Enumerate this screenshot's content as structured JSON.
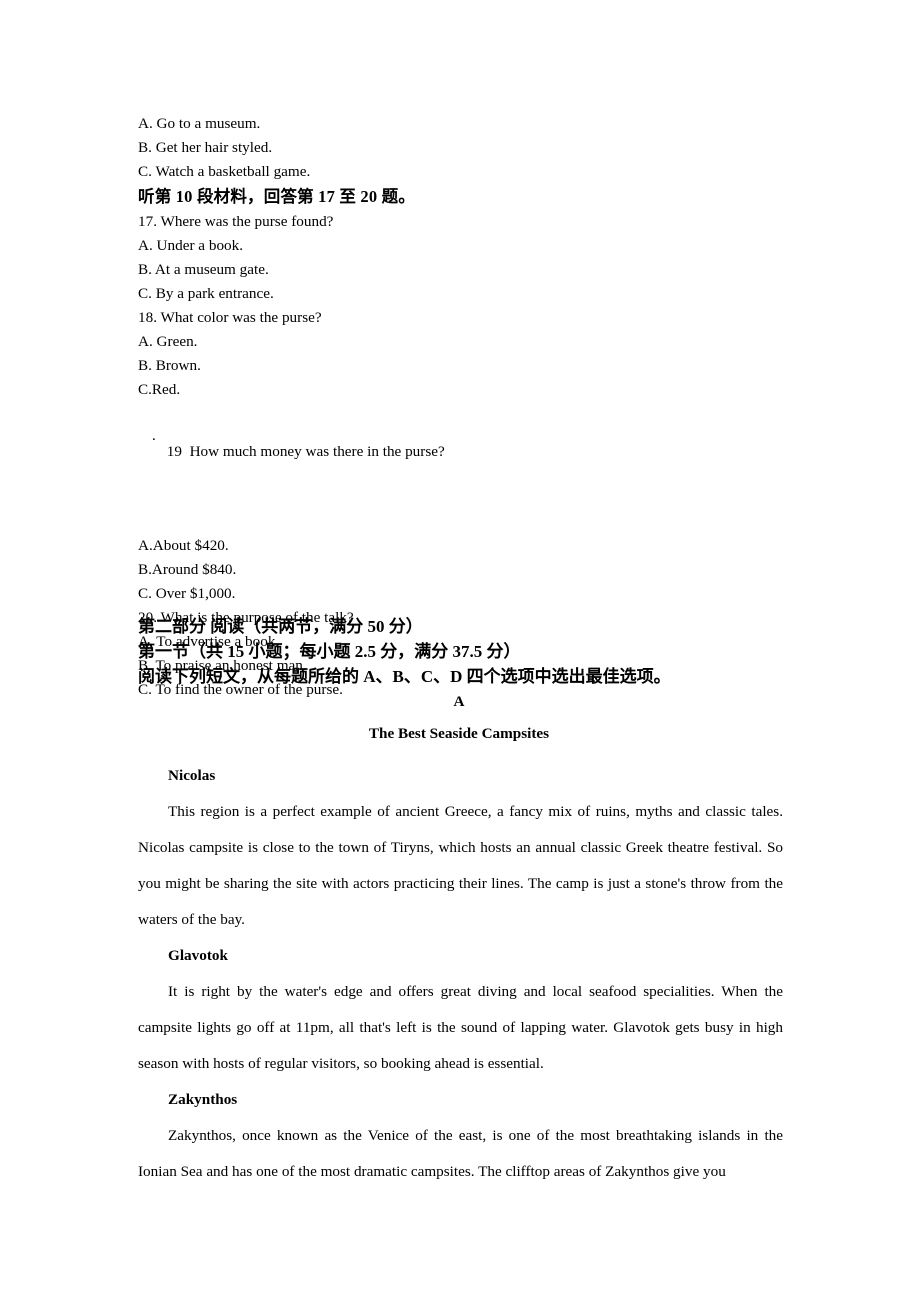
{
  "listening": {
    "options_prev": [
      "A. Go to a museum.",
      "B. Get her hair styled.",
      "C. Watch a basketball game."
    ],
    "material_heading": "听第 10 段材料，回答第 17 至 20 题。",
    "q17": {
      "stem": "17. Where was the purse found?",
      "options": [
        "A. Under a book.",
        "B. At a museum gate.",
        "C. By a park entrance."
      ]
    },
    "q18": {
      "stem": "18. What color was the purse?",
      "options": [
        "A. Green.",
        "B. Brown.",
        "C.Red."
      ]
    },
    "q19": {
      "stem": "19  How much money was there in the purse?",
      "stray_period": ".",
      "options": [
        "A.About $420.",
        "B.Around $840.",
        "C. Over $1,000."
      ]
    },
    "q20": {
      "stem": "20. What is the purpose of the talk?",
      "options": [
        "A. To advertise a book.",
        "B. To praise an honest man.",
        "C. To find the owner of the purse."
      ]
    }
  },
  "section": {
    "part_two": "第二部分 阅读（共两节，满分 50 分）",
    "subsection_one": "第一节（共 15 小题；每小题 2.5 分，满分 37.5 分）",
    "instruction": "阅读下列短文，从每题所给的 A、B、C、D 四个选项中选出最佳选项。"
  },
  "passage": {
    "letter": "A",
    "title": "The Best Seaside Campsites",
    "entries": [
      {
        "name": "Nicolas",
        "text": "This region is a perfect example of ancient Greece, a fancy mix of ruins, myths and classic tales. Nicolas campsite is close to the town of Tiryns, which hosts an annual classic Greek theatre festival. So you might be sharing the site with actors practicing their lines. The camp is just a stone's throw from the waters of the bay."
      },
      {
        "name": "Glavotok",
        "text": "It is right by the water's edge and offers great diving and local seafood specialities. When the campsite lights go off at 11pm, all that's left is the sound of lapping water. Glavotok gets busy in high season with hosts of regular visitors, so booking ahead is essential."
      },
      {
        "name": "Zakynthos",
        "text": "Zakynthos, once known as the Venice of the east, is one of the most breathtaking islands in the Ionian Sea and has one of the most dramatic campsites. The clifftop areas of Zakynthos give you"
      }
    ]
  },
  "colors": {
    "text": "#000000",
    "background": "#ffffff"
  }
}
